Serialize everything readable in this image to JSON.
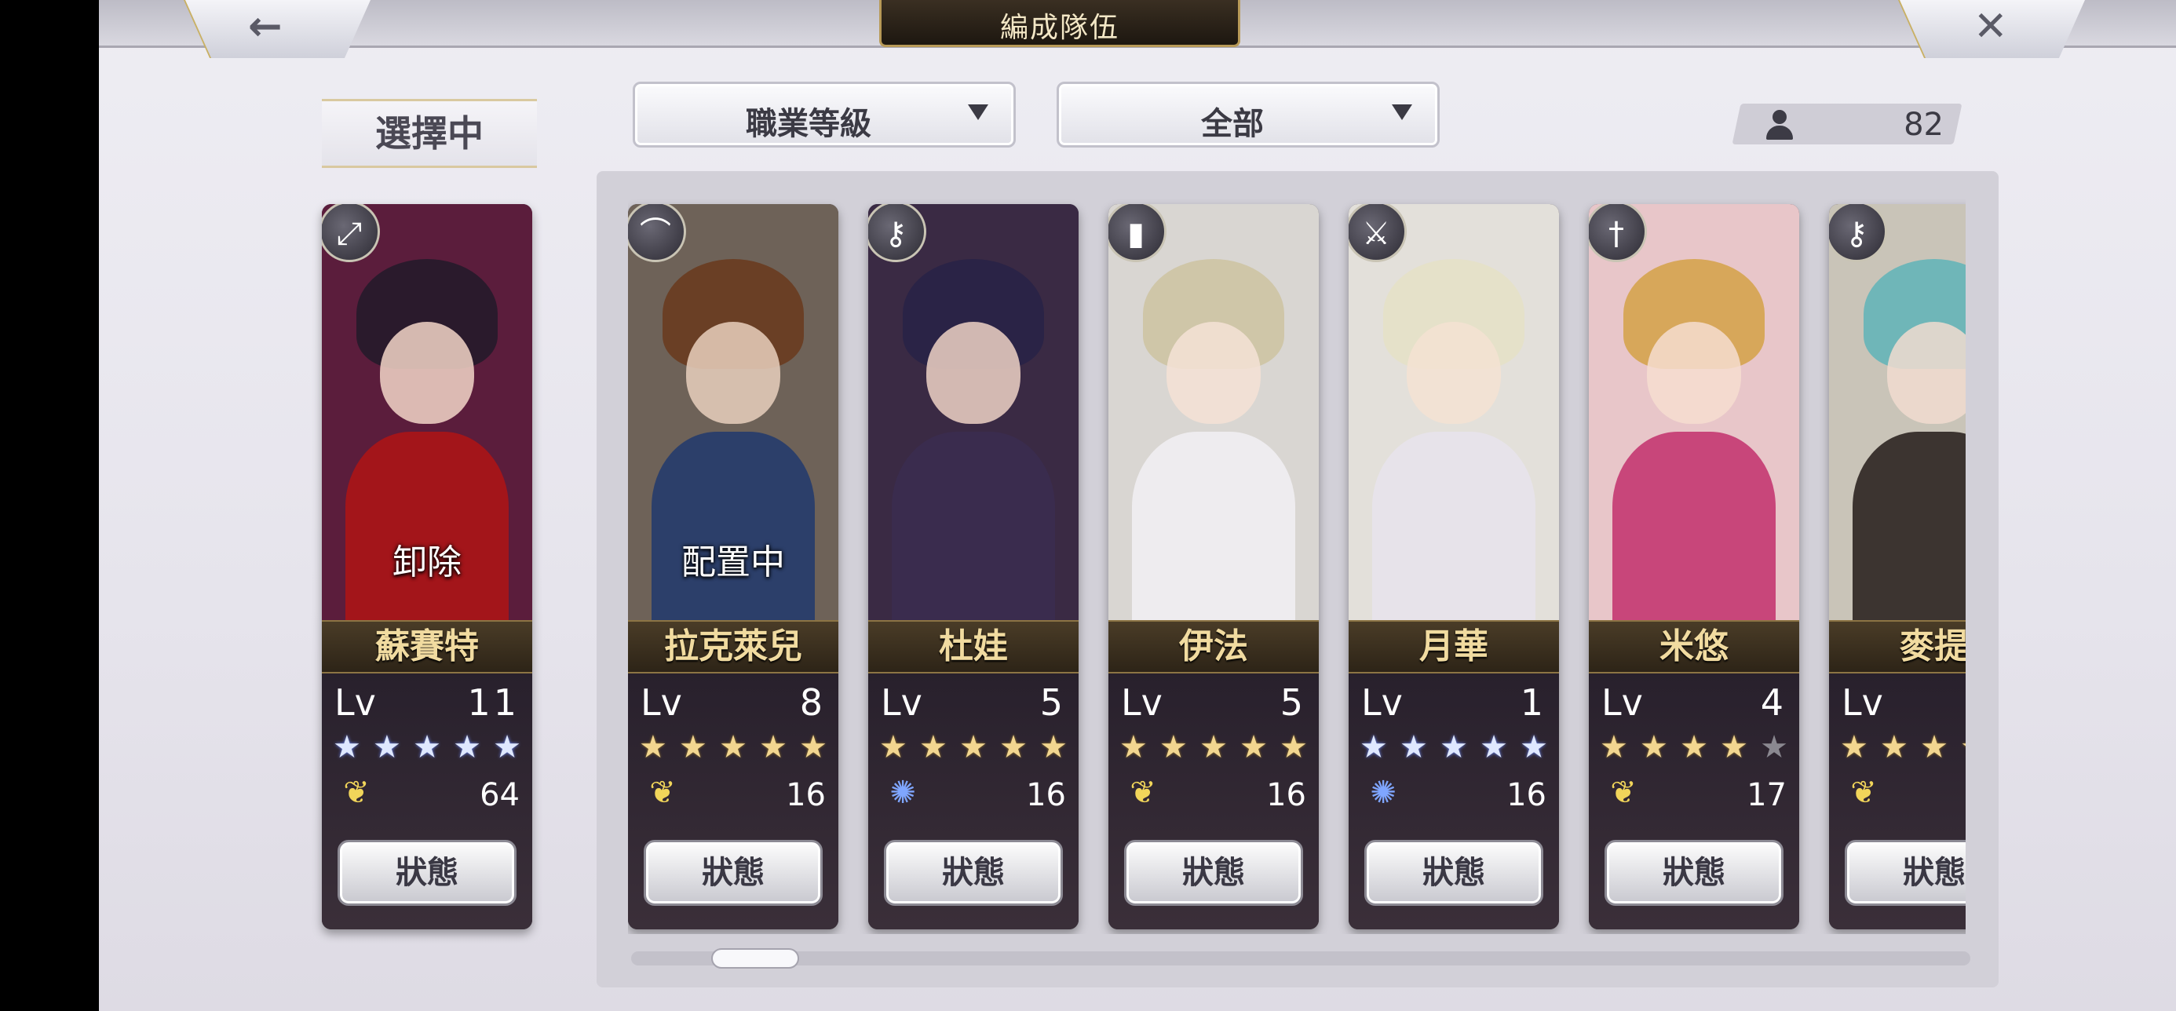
{
  "header": {
    "title": "編成隊伍",
    "back_icon": "←",
    "close_icon": "✕"
  },
  "selected_label": "選擇中",
  "filters": [
    {
      "label": "職業等級"
    },
    {
      "label": "全部"
    }
  ],
  "unit_count": "82",
  "status_label": "狀態",
  "cards": [
    {
      "name": "蘇賽特",
      "overlay": "卸除",
      "lv_label": "Lv",
      "level": "11",
      "star_color": "blue",
      "stars_total": 5,
      "stars_filled": 5,
      "element": "wing",
      "cost": "64",
      "class_icon": "⤢",
      "colors": {
        "bg": "#5b1d3c",
        "hair": "#2a1a2c",
        "face": "#f3d6c8",
        "torso": "#a3151a"
      }
    },
    {
      "name": "拉克萊兒",
      "overlay": "配置中",
      "lv_label": "Lv",
      "level": "8",
      "star_color": "gold",
      "stars_total": 5,
      "stars_filled": 5,
      "element": "wing",
      "cost": "16",
      "class_icon": "⌒",
      "colors": {
        "bg": "#6e6258",
        "hair": "#6a3f25",
        "face": "#e9d0bd",
        "torso": "#2c3f6a"
      }
    },
    {
      "name": "杜娃",
      "overlay": "",
      "lv_label": "Lv",
      "level": "5",
      "star_color": "gold",
      "stars_total": 5,
      "stars_filled": 5,
      "element": "swirl",
      "cost": "16",
      "class_icon": "⚷",
      "colors": {
        "bg": "#3a2a44",
        "hair": "#2a2346",
        "face": "#efd2c6",
        "torso": "#3a2c4e"
      }
    },
    {
      "name": "伊法",
      "overlay": "",
      "lv_label": "Lv",
      "level": "5",
      "star_color": "gold",
      "stars_total": 5,
      "stars_filled": 5,
      "element": "wing",
      "cost": "16",
      "class_icon": "▮",
      "colors": {
        "bg": "#d9d6d2",
        "hair": "#cfc6a8",
        "face": "#f4e2d6",
        "torso": "#eeecef"
      }
    },
    {
      "name": "月華",
      "overlay": "",
      "lv_label": "Lv",
      "level": "1",
      "star_color": "blue",
      "stars_total": 5,
      "stars_filled": 5,
      "element": "swirl",
      "cost": "16",
      "class_icon": "⚔",
      "colors": {
        "bg": "#e3e0da",
        "hair": "#e5e1c9",
        "face": "#f5e2d2",
        "torso": "#e7e3ea"
      }
    },
    {
      "name": "米悠",
      "overlay": "",
      "lv_label": "Lv",
      "level": "4",
      "star_color": "gold",
      "stars_total": 5,
      "stars_filled": 4,
      "element": "wing",
      "cost": "17",
      "class_icon": "†",
      "colors": {
        "bg": "#e8c6c9",
        "hair": "#d7a75a",
        "face": "#f6ddd0",
        "torso": "#c8467a"
      }
    },
    {
      "name": "麥提",
      "overlay": "",
      "lv_label": "Lv",
      "level": "",
      "star_color": "gold",
      "stars_total": 5,
      "stars_filled": 5,
      "element": "wing",
      "cost": "",
      "class_icon": "⚷",
      "colors": {
        "bg": "#c9c4b8",
        "hair": "#6fb6b8",
        "face": "#f1dccf",
        "torso": "#3c3430"
      }
    }
  ],
  "scroll": {
    "position": 0.06
  }
}
